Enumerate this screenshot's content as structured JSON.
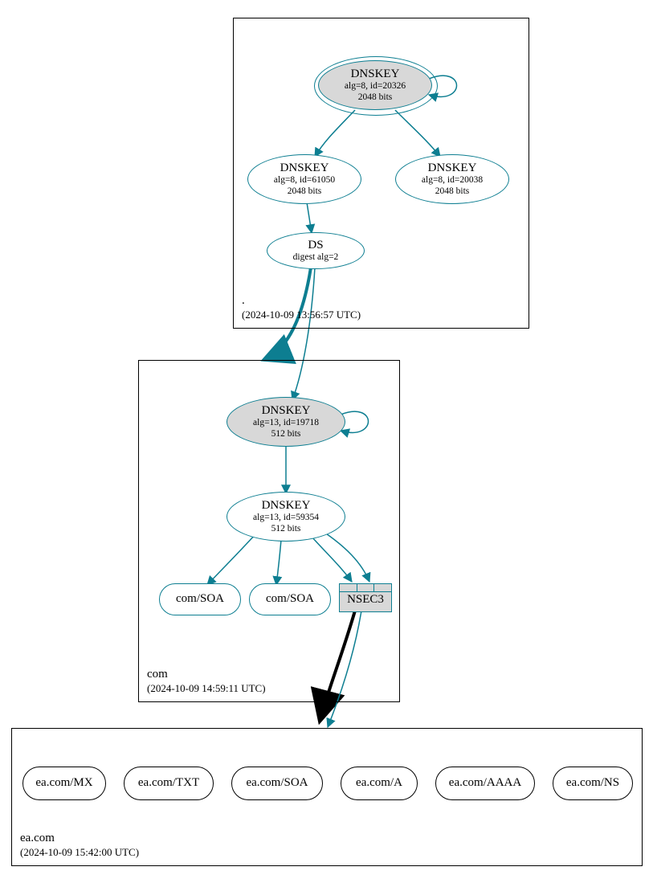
{
  "zones": {
    "root": {
      "name": ".",
      "ts": "(2024-10-09 13:56:57 UTC)"
    },
    "com": {
      "name": "com",
      "ts": "(2024-10-09 14:59:11 UTC)"
    },
    "ea": {
      "name": "ea.com",
      "ts": "(2024-10-09 15:42:00 UTC)"
    }
  },
  "root": {
    "ksk": {
      "title": "DNSKEY",
      "sub1": "alg=8, id=20326",
      "sub2": "2048 bits"
    },
    "zsk1": {
      "title": "DNSKEY",
      "sub1": "alg=8, id=61050",
      "sub2": "2048 bits"
    },
    "zsk2": {
      "title": "DNSKEY",
      "sub1": "alg=8, id=20038",
      "sub2": "2048 bits"
    },
    "ds": {
      "title": "DS",
      "sub1": "digest alg=2"
    }
  },
  "com": {
    "ksk": {
      "title": "DNSKEY",
      "sub1": "alg=13, id=19718",
      "sub2": "512 bits"
    },
    "zsk": {
      "title": "DNSKEY",
      "sub1": "alg=13, id=59354",
      "sub2": "512 bits"
    },
    "soa1": "com/SOA",
    "soa2": "com/SOA",
    "nsec3": "NSEC3"
  },
  "ea": {
    "r1": "ea.com/MX",
    "r2": "ea.com/TXT",
    "r3": "ea.com/SOA",
    "r4": "ea.com/A",
    "r5": "ea.com/AAAA",
    "r6": "ea.com/NS"
  }
}
